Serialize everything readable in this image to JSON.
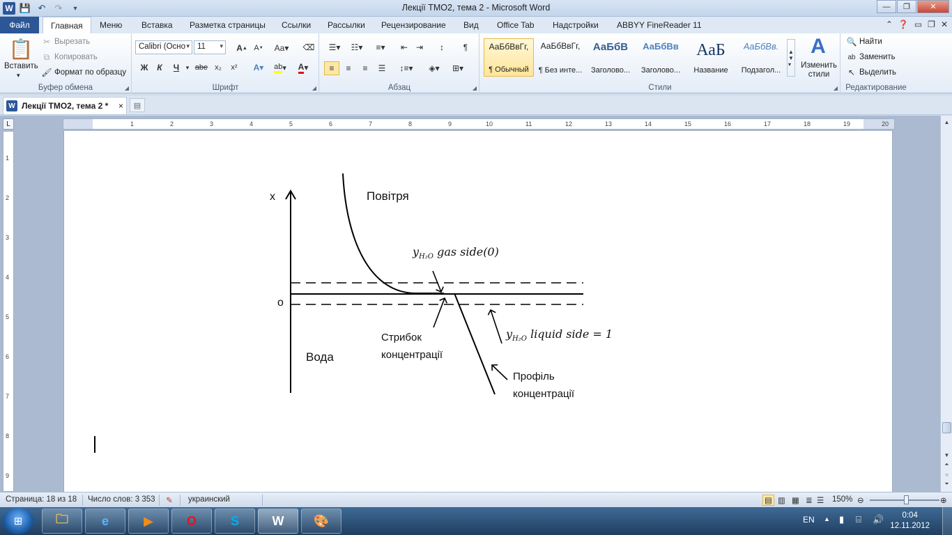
{
  "window": {
    "title": "Лекції ТМО2, тема 2  -  Microsoft Word",
    "icon": "word-app-icon"
  },
  "quick_access": [
    "save-icon",
    "undo-icon",
    "redo-icon",
    "customize-icon"
  ],
  "tabs": {
    "file": "Файл",
    "items": [
      "Главная",
      "Меню",
      "Вставка",
      "Разметка страницы",
      "Ссылки",
      "Рассылки",
      "Рецензирование",
      "Вид",
      "Office Tab",
      "Надстройки",
      "ABBYY FineReader 11"
    ],
    "active": "Главная"
  },
  "ribbon": {
    "clipboard": {
      "label": "Буфер обмена",
      "paste": "Вставить",
      "cut": "Вырезать",
      "copy": "Копировать",
      "format_painter": "Формат по образцу"
    },
    "font": {
      "label": "Шрифт",
      "font_name": "Calibri (Осно",
      "font_size": "11",
      "bold": "Ж",
      "italic": "К",
      "underline": "Ч",
      "strike": "abe"
    },
    "paragraph": {
      "label": "Абзац"
    },
    "styles": {
      "label": "Стили",
      "items": [
        {
          "sample": "АаБбВвГг,",
          "name": "¶ Обычный",
          "color": "#000000"
        },
        {
          "sample": "АаБбВвГг,",
          "name": "¶ Без инте...",
          "color": "#000000"
        },
        {
          "sample": "АаБбВ",
          "name": "Заголово...",
          "color": "#365f91"
        },
        {
          "sample": "АаБбВв",
          "name": "Заголово...",
          "color": "#4f81bd"
        },
        {
          "sample": "АаБ",
          "name": "Название",
          "color": "#17365d"
        },
        {
          "sample": "АаБбВв.",
          "name": "Подзагол...",
          "color": "#4f81bd"
        }
      ],
      "change_styles": "Изменить стили"
    },
    "editing": {
      "label": "Редактирование",
      "find": "Найти",
      "replace": "Заменить",
      "select": "Выделить"
    }
  },
  "doc_tab": {
    "label": "Лекції ТМО2, тема 2 *",
    "close": "×"
  },
  "ruler": {
    "h_numbers": [
      "1",
      "2",
      "3",
      "4",
      "5",
      "6",
      "7",
      "8",
      "9",
      "10",
      "11",
      "12",
      "13",
      "14",
      "15",
      "16",
      "17",
      "18",
      "19",
      "20"
    ],
    "v_numbers": [
      "1",
      "2",
      "3",
      "4",
      "5",
      "6",
      "7",
      "8",
      "9"
    ]
  },
  "diagram": {
    "axis_x_label": "x",
    "origin_label": "o",
    "air_label": "Повітря",
    "water_label": "Вода",
    "gas_side_label": {
      "y": "y",
      "sub": "H₂O",
      "rest": " gas side(0)"
    },
    "liquid_side_label": {
      "y": "y",
      "sub": "H₂O",
      "rest": " liquid side = 1"
    },
    "jump_label_1": "Стрибок",
    "jump_label_2": "концентрації",
    "profile_label_1": "Профіль",
    "profile_label_2": "концентрації"
  },
  "status": {
    "page": "Страница: 18 из 18",
    "words": "Число слов: 3 353",
    "language": "украинский",
    "zoom": "150%"
  },
  "taskbar": {
    "apps": [
      "explorer-icon",
      "ie-icon",
      "media-player-icon",
      "opera-icon",
      "skype-icon",
      "word-icon",
      "paint-icon"
    ],
    "lang": "EN",
    "time": "0:04",
    "date": "12.11.2012"
  }
}
